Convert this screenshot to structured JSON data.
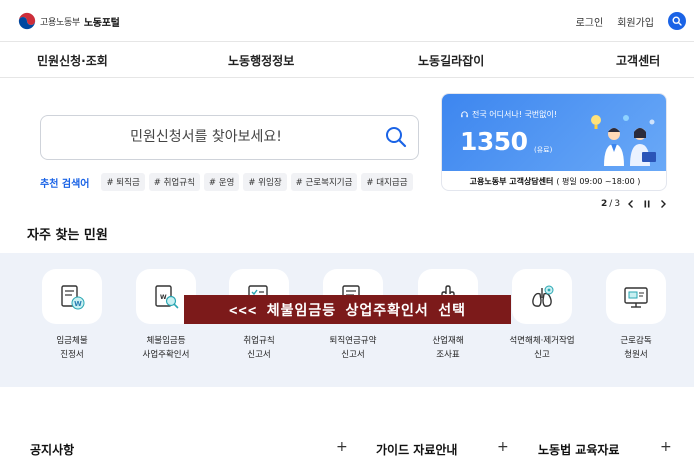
{
  "header": {
    "ministry": "고용노동부",
    "portal": "노동포털",
    "login": "로그인",
    "signup": "회원가입"
  },
  "gnb": {
    "items": [
      "민원신청·조회",
      "노동행정정보",
      "노동길라잡이",
      "고객센터"
    ]
  },
  "search": {
    "placeholder": "민원신청서를 찾아보세요!",
    "recommend_label": "추천 검색어",
    "tags": [
      "# 퇴직금",
      "# 취업규칙",
      "# 운영",
      "# 위임장",
      "# 근로복지기금",
      "# 대지급금"
    ]
  },
  "banner": {
    "subtitle": "전국 어디서나! 국번없이!",
    "number": "1350",
    "unit": "(유료)",
    "center": "고용노동부 고객상담센터",
    "hours": "( 평일 09:00 ~18:00 )"
  },
  "pager": {
    "current": "2",
    "sep": "/",
    "total": "3"
  },
  "frequent": {
    "title": "자주 찾는 민원",
    "items": [
      {
        "line1": "임금체불",
        "line2": "진정서",
        "icon": "wage-document-icon"
      },
      {
        "line1": "체불임금등",
        "line2": "사업주확인서",
        "icon": "search-document-icon"
      },
      {
        "line1": "취업규칙",
        "line2": "신고서",
        "icon": "checklist-icon"
      },
      {
        "line1": "퇴직연금규약",
        "line2": "신고서",
        "icon": "pension-document-icon"
      },
      {
        "line1": "산업재해",
        "line2": "조사표",
        "icon": "injury-hand-icon"
      },
      {
        "line1": "석면해체·제거작업",
        "line2": "신고",
        "icon": "lungs-icon"
      },
      {
        "line1": "근로감독",
        "line2": "청원서",
        "icon": "monitor-icon"
      }
    ]
  },
  "overlay": {
    "text": "<<< 체불임금등 상업주확인서 선택"
  },
  "bottom": {
    "notice": "공지사항",
    "guide": "가이드 자료안내",
    "education": "노동법 교육자료",
    "plus": "+"
  },
  "colors": {
    "accent": "#1a63e6",
    "banner": "#4a90f0",
    "freq_bg": "#eef2f9",
    "overlay": "#7c1a1a"
  }
}
